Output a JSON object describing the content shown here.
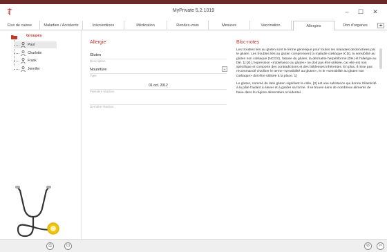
{
  "window": {
    "title": "MyPrivate 5.2.1019",
    "minimize_glyph": "–",
    "maximize_glyph": "☐",
    "close_glyph": "✕",
    "accent_color": "#c0392b",
    "topbar_color": "#6b2a27",
    "app_icon": "caduceus-icon"
  },
  "tabs": [
    {
      "label": "Flux de caisse",
      "active": false
    },
    {
      "label": "Maladies / Accidents",
      "active": false
    },
    {
      "label": "Interventions",
      "active": false
    },
    {
      "label": "Médication",
      "active": false
    },
    {
      "label": "Rendez-vous",
      "active": false
    },
    {
      "label": "Mesures",
      "active": false
    },
    {
      "label": "Vaccination",
      "active": false
    },
    {
      "label": "Allergies",
      "active": true
    },
    {
      "label": "Don d'organes",
      "active": false
    }
  ],
  "tabs_scroll_glyph": "◂▸",
  "tree": {
    "root_label": "Groupés",
    "root_icon": "folder-icon",
    "items": [
      {
        "name": "Paul",
        "selected": true,
        "icon": "person-icon"
      },
      {
        "name": "Charlotte",
        "selected": false,
        "icon": "person-icon"
      },
      {
        "name": "Frank",
        "selected": false,
        "icon": "person-icon"
      },
      {
        "name": "Jennifer",
        "selected": false,
        "icon": "person-icon"
      }
    ]
  },
  "illustration": "stethoscope-icon",
  "form": {
    "title": "Allergie",
    "description_value": "Gluten",
    "description_label": "Description",
    "type_value": "Nourriture",
    "type_label": "Type",
    "dropdown_glyph": "⌄",
    "first_reaction_value": "01 oct. 2012",
    "first_reaction_label": "Première réaction",
    "last_reaction_value": "",
    "last_reaction_label": "Dernière réaction"
  },
  "notes": {
    "title": "Bloc-notes",
    "paragraphs": [
      "Les troubles liés au gluten sont le terme générique pour toutes les maladies déclenchées par le gluten. Les troubles liés au gluten comprennent la maladie cœliaque (CD), la sensibilité au gluten non cœliaque (NCGS), l'ataxie du gluten, la dermatite herpétiforme (DH) et l'allergie au blé. 1] [2] L'expression «intolérance au gluten» ne doit pas être utilisée, car elle est non spécifique et comporte des contradictions et des faiblesses inhérentes. En plus, il mise pas recommandé d'utiliser le terme «sensibilité au gluten», et le «sensibilité au gluten non cœliaque» doit être utilisée à la place. 1]",
      "Le gluten, nommé du latin gluten signifiant la colle, [3] est une substance qui donne l'élasticité à la pâte l'aidant à élever et à garder sa forme. Il se trouve dans de nombreux aliments de base dans le régime alimentaire occidental."
    ]
  },
  "bottom": {
    "left_buttons": [
      {
        "name": "print-button",
        "glyph": "⎙"
      },
      {
        "name": "export-button",
        "glyph": "⊡"
      }
    ],
    "right_buttons": [
      {
        "name": "attach-button",
        "glyph": "⊘"
      },
      {
        "name": "back-button",
        "glyph": "⇦"
      }
    ]
  }
}
